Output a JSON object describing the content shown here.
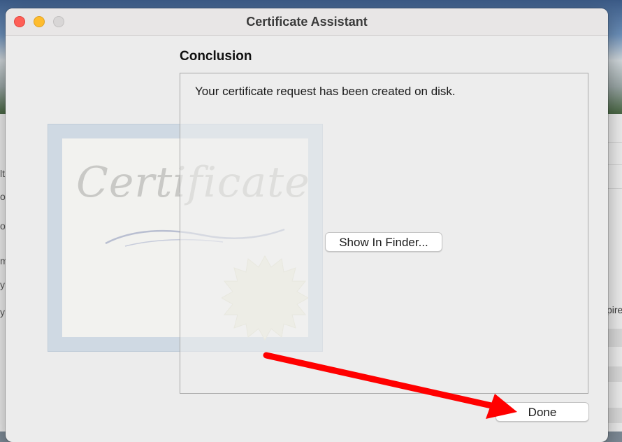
{
  "window": {
    "title": "Certificate Assistant"
  },
  "section": {
    "heading": "Conclusion",
    "message": "Your certificate request has been created on disk."
  },
  "buttons": {
    "show_in_finder": "Show In Finder...",
    "done": "Done"
  },
  "illustration": {
    "label": "Certificate"
  },
  "background_window": {
    "partial_text": "pire",
    "left_edge_chars": [
      "lt",
      "o",
      "o",
      "m",
      "y",
      "y"
    ]
  },
  "colors": {
    "close": "#fe5f57",
    "minimize": "#febc2e",
    "zoom": "#d8d6d6",
    "annotation_arrow": "#ff0000"
  }
}
